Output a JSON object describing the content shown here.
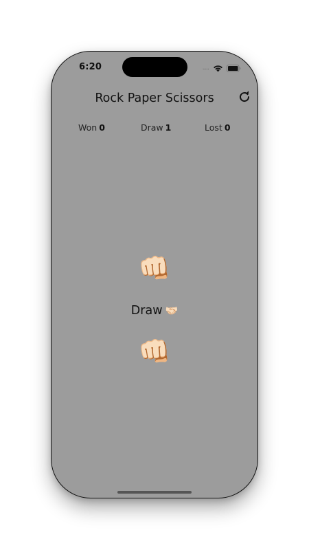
{
  "status_bar": {
    "time": "6:20",
    "icons": [
      "signal-dots-icon",
      "wifi-icon",
      "battery-icon"
    ],
    "signal_text": "....."
  },
  "header": {
    "title": "Rock Paper Scissors",
    "refresh_icon": "refresh-icon"
  },
  "scores": {
    "won": {
      "label": "Won",
      "value": "0"
    },
    "draw": {
      "label": "Draw",
      "value": "1"
    },
    "lost": {
      "label": "Lost",
      "value": "0"
    }
  },
  "game": {
    "opponent_hand": "👊🏻",
    "result_text": "Draw",
    "result_emoji": "🤝🏻",
    "player_hand": "👊🏻"
  },
  "colors": {
    "screen_background": "#9c9c9c",
    "text": "#111111"
  }
}
